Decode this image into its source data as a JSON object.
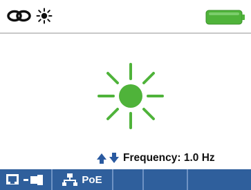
{
  "status_bar": {
    "link_icon": "chain-link-icon",
    "light_icon": "flashing-light-icon",
    "battery_icon": "battery-full-icon",
    "battery_color": "#4fb33a"
  },
  "main": {
    "indicator_icon": "sun-light-icon",
    "indicator_color": "#4fb33a",
    "arrows_icon": "up-down-arrows-icon",
    "arrow_color": "#2a5aa0",
    "frequency_label": "Frequency: 1.0 Hz"
  },
  "softkeys": [
    {
      "icon": "port-connector-icon",
      "label": ""
    },
    {
      "icon": "network-icon",
      "label": "PoE"
    },
    {
      "icon": "",
      "label": ""
    },
    {
      "icon": "",
      "label": ""
    },
    {
      "icon": "",
      "label": ""
    }
  ],
  "colors": {
    "softkey_bar": "#2f5f9c",
    "softkey_divider": "#6f93c4",
    "background": "#ffffff"
  }
}
